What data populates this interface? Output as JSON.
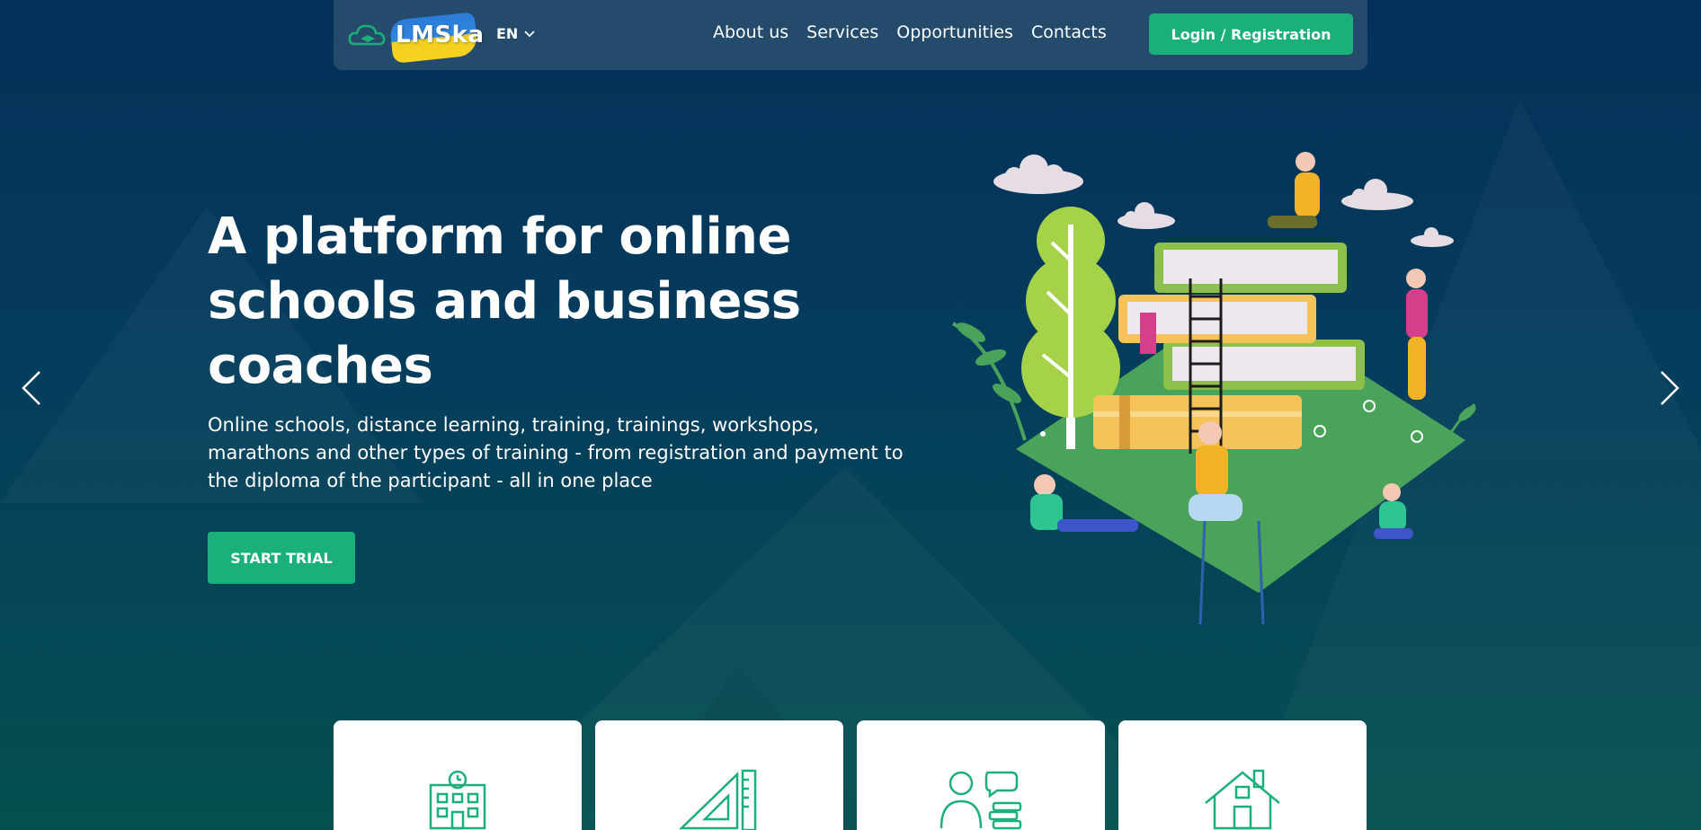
{
  "nav": {
    "logo_text": "LMSka",
    "language": "EN",
    "menu": [
      "About us",
      "Services",
      "Opportunities",
      "Contacts"
    ],
    "login_label": "Login / Registration"
  },
  "hero": {
    "title": "A platform for online schools and business coaches",
    "subtitle": "Online schools, distance learning, training, trainings, workshops, marathons and other types of training - from registration and payment to the diploma of the participant - all in one place",
    "cta_label": "START TRIAL"
  },
  "icons": {
    "prev": "chevron-left-icon",
    "next": "chevron-right-icon",
    "cards": [
      "school-building-icon",
      "ruler-triangle-icon",
      "teacher-student-icon",
      "house-icon"
    ]
  },
  "colors": {
    "accent": "#1bb07a",
    "nav_bg": "#244a6c",
    "bg_top": "#04305a",
    "bg_bottom": "#055050"
  }
}
